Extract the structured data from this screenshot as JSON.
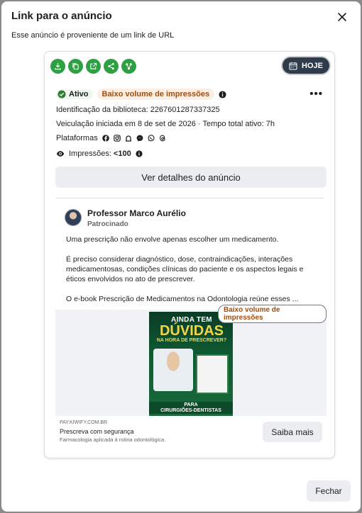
{
  "dialog": {
    "title": "Link para o anúncio",
    "subtitle": "Esse anúncio é proveniente de um link de URL",
    "close_footer_label": "Fechar"
  },
  "toolbar": {
    "icons": [
      "download-icon",
      "copy-icon",
      "open-external-icon",
      "share-icon",
      "connections-icon"
    ],
    "hoje_label": "HOJE"
  },
  "status": {
    "active_label": "Ativo",
    "low_volume_label": "Baixo volume de impressões",
    "more_label": "•••"
  },
  "meta": {
    "library_id": "Identificação da biblioteca: 2267601287337325",
    "run_info": "Veiculação iniciada em 8 de set de 2026 · Tempo total ativo: 7h",
    "platforms_label": "Plataformas",
    "platform_icons": [
      "facebook-icon",
      "instagram-icon",
      "audience-network-icon",
      "messenger-icon",
      "whatsapp-icon",
      "threads-icon"
    ],
    "impressions_label": "Impressões:",
    "impressions_value": "<100"
  },
  "details_button": "Ver detalhes do anúncio",
  "ad": {
    "advertiser": "Professor Marco Aurélio",
    "sponsored": "Patrocinado",
    "text": [
      "Uma prescrição não envolve apenas escolher um medicamento.",
      "É preciso considerar diagnóstico, dose, contraindicações, interações medicamentosas, condições clínicas do paciente e os aspectos legais e éticos envolvidos no ato de prescrever.",
      "O e-book Prescrição de Medicamentos na Odontologia reúne esses ..."
    ],
    "media_badge": "Baixo volume de impressões",
    "creative": {
      "line1": "AINDA TEM",
      "line2": "DÚVIDAS",
      "line3": "NA HORA DE PRESCREVER?",
      "banner_line1": "PARA",
      "banner_line2": "CIRURGIÕES-DENTISTAS"
    },
    "link_domain": "PAY.KIWIFY.COM.BR",
    "link_title": "Prescreva com segurança",
    "link_description": "Farmacologia aplicada à rotina odontológica.",
    "cta_label": "Saiba mais"
  },
  "colors": {
    "accent_green": "#2ea043",
    "low_volume_text": "#a14d0c",
    "hoje_bg": "#2f3a4a"
  }
}
